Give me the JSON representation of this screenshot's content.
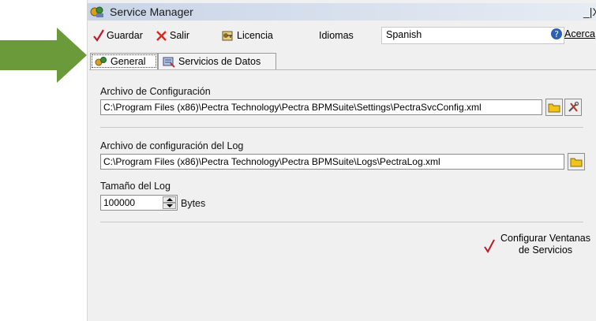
{
  "window": {
    "title": "Service Manager",
    "close_label": "_|X"
  },
  "toolbar": {
    "save_label": "Guardar",
    "exit_label": "Salir",
    "license_label": "Licencia",
    "languages_label": "Idiomas",
    "language_selected": "Spanish",
    "about_label": "Acerca"
  },
  "tabs": [
    {
      "label": "General",
      "active": true
    },
    {
      "label": "Servicios de Datos",
      "active": false
    }
  ],
  "general": {
    "config_file_label": "Archivo de Configuración",
    "config_file_value": "C:\\Program Files (x86)\\Pectra Technology\\Pectra BPMSuite\\Settings\\PectraSvcConfig.xml",
    "log_config_label": "Archivo de configuración del Log",
    "log_config_value": "C:\\Program Files (x86)\\Pectra Technology\\Pectra BPMSuite\\Logs\\PectraLog.xml",
    "log_size_label": "Tamaño del Log",
    "log_size_value": "100000",
    "log_size_unit": "Bytes",
    "configure_windows_label": "Configurar Ventanas de Servicios"
  },
  "colors": {
    "annotation_arrow": "#6a9a3a",
    "check_red": "#c0182a",
    "exit_red": "#d42a20",
    "folder_yellow": "#f0c419"
  }
}
